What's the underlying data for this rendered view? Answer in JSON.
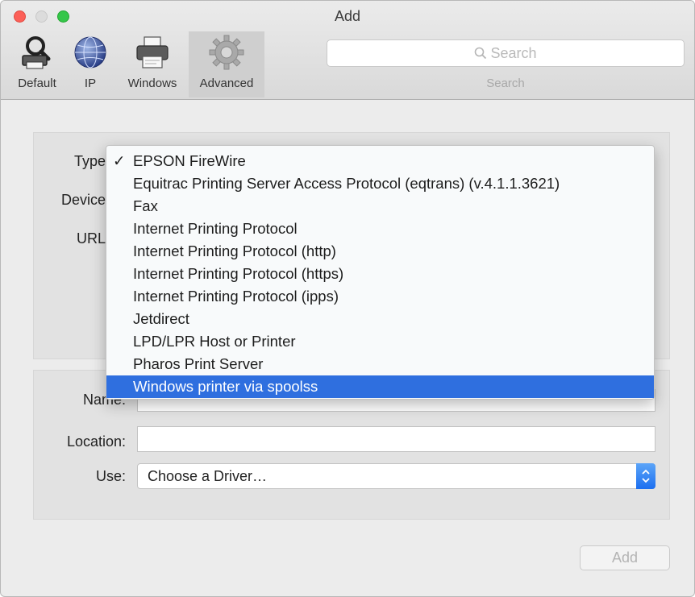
{
  "window": {
    "title": "Add"
  },
  "toolbar": {
    "tools": [
      {
        "label": "Default",
        "icon": "default-printer-icon"
      },
      {
        "label": "IP",
        "icon": "globe-icon"
      },
      {
        "label": "Windows",
        "icon": "printer-icon"
      },
      {
        "label": "Advanced",
        "icon": "gear-icon",
        "selected": true
      }
    ],
    "search": {
      "placeholder": "Search",
      "caption": "Search"
    }
  },
  "form": {
    "type_label": "Type",
    "device_label": "Device",
    "url_label": "URL",
    "name_label": "Name:",
    "location_label": "Location:",
    "location_value": "",
    "use_label": "Use:",
    "use_value": "Choose a Driver…"
  },
  "type_menu": {
    "checked_index": 0,
    "highlighted_index": 10,
    "items": [
      "EPSON FireWire",
      "Equitrac Printing Server Access Protocol (eqtrans) (v.4.1.1.3621)",
      "Fax",
      "Internet Printing Protocol",
      "Internet Printing Protocol (http)",
      "Internet Printing Protocol (https)",
      "Internet Printing Protocol (ipps)",
      "Jetdirect",
      "LPD/LPR Host or Printer",
      "Pharos Print Server",
      "Windows printer via spoolss"
    ],
    "check_glyph": "✓"
  },
  "buttons": {
    "add_label": "Add"
  },
  "colors": {
    "highlight": "#2f6fdf",
    "stepper": "#1c6ff0",
    "close": "#fc5f57",
    "zoom": "#35c649"
  }
}
